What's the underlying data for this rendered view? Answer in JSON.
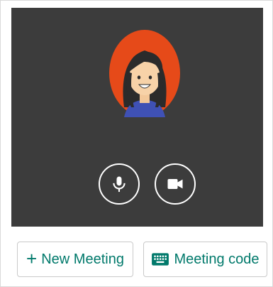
{
  "colors": {
    "preview_background": "#3c3c3c",
    "accent": "#00796b",
    "avatar_background": "#e64a19",
    "control_outline": "#ffffff"
  },
  "preview": {
    "avatar": {
      "icon": "user-avatar-illustration"
    },
    "controls": [
      {
        "icon": "microphone-icon"
      },
      {
        "icon": "video-camera-icon"
      }
    ]
  },
  "actions": {
    "new_meeting": {
      "label": "New Meeting",
      "icon": "plus-icon",
      "icon_glyph": "+"
    },
    "meeting_code": {
      "label": "Meeting code",
      "icon": "keyboard-icon"
    }
  }
}
